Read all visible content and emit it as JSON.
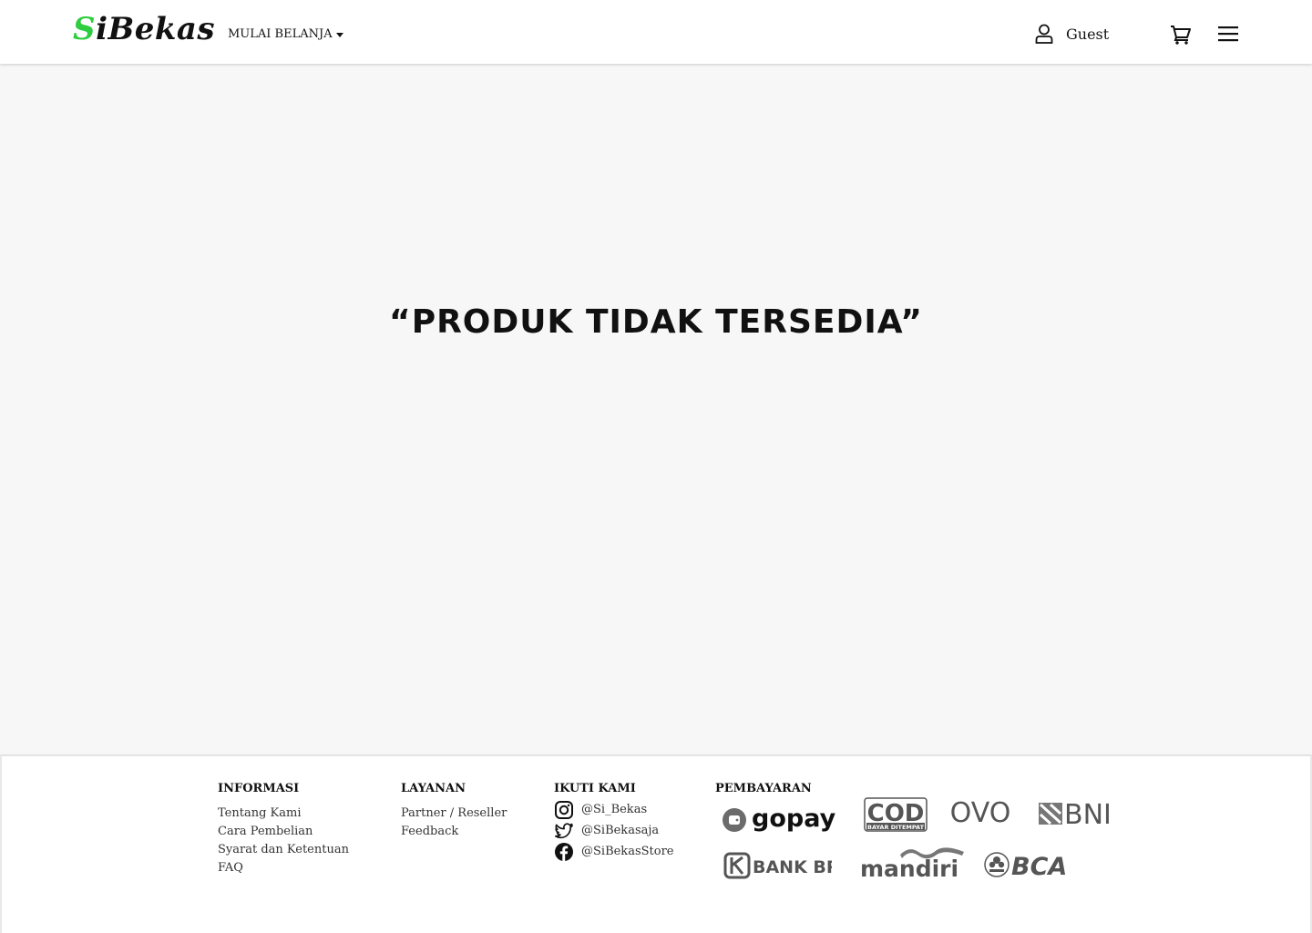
{
  "header": {
    "logo_first": "S",
    "logo_rest": "iBekas",
    "shop_label": "MULAI BELANJA",
    "user_label": "Guest"
  },
  "main": {
    "message": "“PRODUK TIDAK TERSEDIA”"
  },
  "footer": {
    "informasi": {
      "title": "INFORMASI",
      "links": [
        "Tentang Kami",
        "Cara Pembelian",
        "Syarat dan Ketentuan",
        "FAQ"
      ]
    },
    "layanan": {
      "title": "LAYANAN",
      "links": [
        "Partner / Reseller",
        "Feedback"
      ]
    },
    "ikuti": {
      "title": "IKUTI KAMI",
      "instagram": "@Si_Bekas",
      "twitter": "@SiBekasaja",
      "facebook": "@SiBekasStore"
    },
    "pembayaran": {
      "title": "PEMBAYARAN",
      "gopay": "gopay",
      "cod": "COD",
      "cod_sub": "BAYAR DITEMPAT",
      "ovo": "OVO",
      "bni": "BNI",
      "bri": "BANK BRI",
      "mandiri": "mandiri",
      "bca": "BCA"
    }
  },
  "colors": {
    "accent": "#2ecc40",
    "page_bg": "#f7f7f7",
    "text": "#111111",
    "logo_gray": "#555555"
  }
}
